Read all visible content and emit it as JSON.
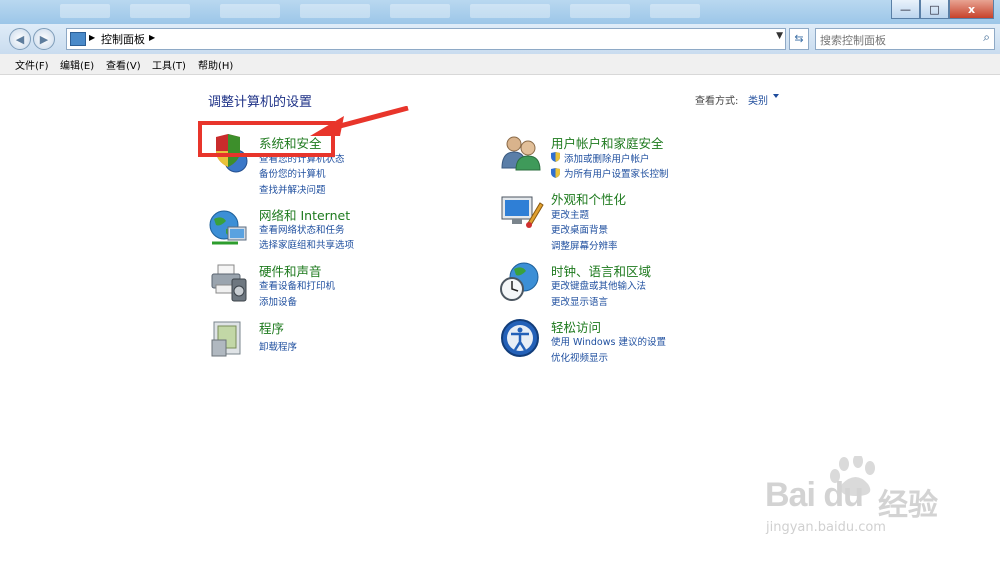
{
  "window": {
    "controls": {
      "minimize": "—",
      "maximize": "□",
      "close": "x"
    }
  },
  "address": {
    "breadcrumb": "控制面板",
    "search_placeholder": "搜索控制面板"
  },
  "menu": [
    "文件(F)",
    "编辑(E)",
    "查看(V)",
    "工具(T)",
    "帮助(H)"
  ],
  "main": {
    "heading": "调整计算机的设置",
    "view_by_label": "查看方式:",
    "view_by_value": "类别"
  },
  "left_categories": [
    {
      "title": "系统和安全",
      "icon": "shield-icon",
      "links": [
        "查看您的计算机状态",
        "备份您的计算机",
        "查找并解决问题"
      ]
    },
    {
      "title": "网络和 Internet",
      "icon": "network-globe-icon",
      "links": [
        "查看网络状态和任务",
        "选择家庭组和共享选项"
      ]
    },
    {
      "title": "硬件和声音",
      "icon": "printer-speaker-icon",
      "links": [
        "查看设备和打印机",
        "添加设备"
      ]
    },
    {
      "title": "程序",
      "icon": "programs-icon",
      "links": [
        "卸载程序"
      ]
    }
  ],
  "right_categories": [
    {
      "title": "用户帐户和家庭安全",
      "icon": "users-icon",
      "links": [
        "添加或删除用户帐户",
        "为所有用户设置家长控制"
      ]
    },
    {
      "title": "外观和个性化",
      "icon": "monitor-paint-icon",
      "links": [
        "更改主题",
        "更改桌面背景",
        "调整屏幕分辨率"
      ]
    },
    {
      "title": "时钟、语言和区域",
      "icon": "clock-globe-icon",
      "links": [
        "更改键盘或其他输入法",
        "更改显示语言"
      ]
    },
    {
      "title": "轻松访问",
      "icon": "ease-of-access-icon",
      "links": [
        "使用 Windows 建议的设置",
        "优化视频显示"
      ]
    }
  ],
  "watermark": {
    "brand": "Bai du",
    "cn": "经验",
    "url": "jingyan.baidu.com"
  },
  "colors": {
    "category_title": "#1e7a1e",
    "link": "#1f4f9f",
    "heading": "#1e3287",
    "annotation": "#e8352b"
  }
}
